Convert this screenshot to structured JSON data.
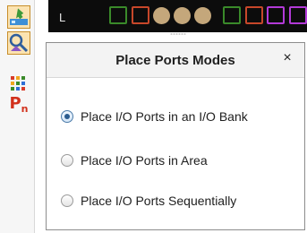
{
  "toolbar": {
    "tools": [
      {
        "icon": "place-ports-icon",
        "active": true
      },
      {
        "icon": "auto-place-icon",
        "active": true
      },
      {
        "icon": "io-bank-grid-icon",
        "active": false
      },
      {
        "icon": "pin-label-icon",
        "active": false
      }
    ],
    "pin_label_text": "P"
  },
  "canvas": {
    "column_label": "L",
    "colors": {
      "background": "#0c0c0c",
      "site_red": "#c7472a",
      "site_green": "#3a8a2a",
      "site_purple": "#b33ad8",
      "pad": "#c4a77b"
    }
  },
  "panel": {
    "title": "Place Ports Modes",
    "close_label": "×",
    "options": [
      {
        "label": "Place I/O Ports in an I/O Bank",
        "selected": true
      },
      {
        "label": "Place I/O Ports in Area",
        "selected": false
      },
      {
        "label": "Place I/O Ports Sequentially",
        "selected": false
      }
    ]
  }
}
